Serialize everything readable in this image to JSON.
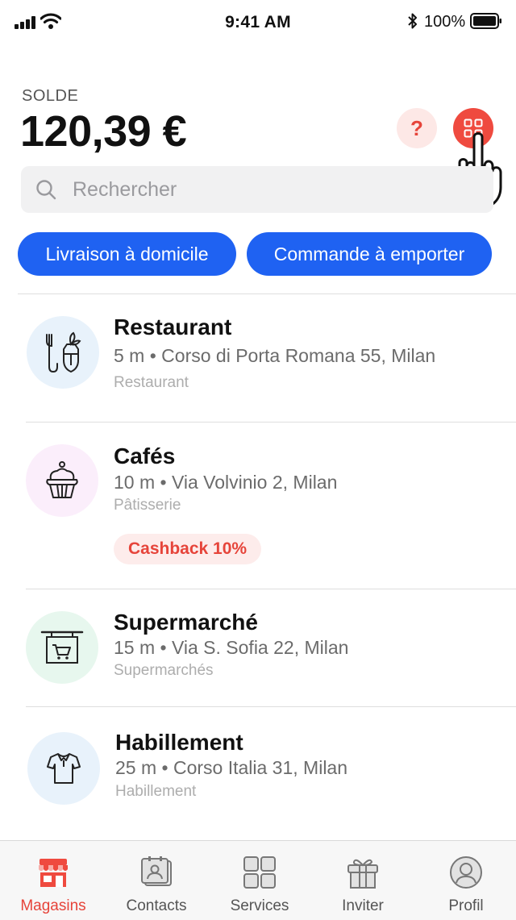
{
  "status_bar": {
    "time": "9:41 AM",
    "battery": "100%"
  },
  "balance": {
    "label": "SOLDE",
    "amount": "120,39 €"
  },
  "header_actions": {
    "help_glyph": "?",
    "help_icon": "question-icon",
    "qr_icon": "qr-code-icon"
  },
  "search": {
    "placeholder": "Rechercher",
    "value": ""
  },
  "filters": [
    {
      "label": "Livraison à domicile"
    },
    {
      "label": "Commande à emporter"
    }
  ],
  "stores": [
    {
      "name": "Restaurant",
      "address": "5 m • Corso di Porta Romana 55, Milan",
      "category": "Restaurant",
      "icon": "restaurant-icon",
      "icon_bg": "#e8f2fb"
    },
    {
      "name": "Cafés",
      "address": "10 m • Via Volvinio 2, Milan",
      "category": "Pâtisserie",
      "badge": "Cashback 10%",
      "icon": "cupcake-icon",
      "icon_bg": "#fbeefb"
    },
    {
      "name": "Supermarché",
      "address": "15 m • Via S. Sofia 22, Milan",
      "category": "Supermarchés",
      "icon": "supermarket-icon",
      "icon_bg": "#e7f7ee"
    },
    {
      "name": "Habillement",
      "address": "25 m • Corso Italia 31, Milan",
      "category": "Habillement",
      "icon": "shirt-icon",
      "icon_bg": "#e8f2fb"
    }
  ],
  "tabs": [
    {
      "label": "Magasins",
      "icon": "store-icon",
      "active": true
    },
    {
      "label": "Contacts",
      "icon": "contacts-icon",
      "active": false
    },
    {
      "label": "Services",
      "icon": "services-grid-icon",
      "active": false
    },
    {
      "label": "Inviter",
      "icon": "gift-icon",
      "active": false
    },
    {
      "label": "Profil",
      "icon": "profile-icon",
      "active": false
    }
  ],
  "colors": {
    "accent_red": "#ef4a3f",
    "primary_blue": "#1f62f2",
    "text_dark": "#111111",
    "text_muted": "#6b6b6b"
  }
}
